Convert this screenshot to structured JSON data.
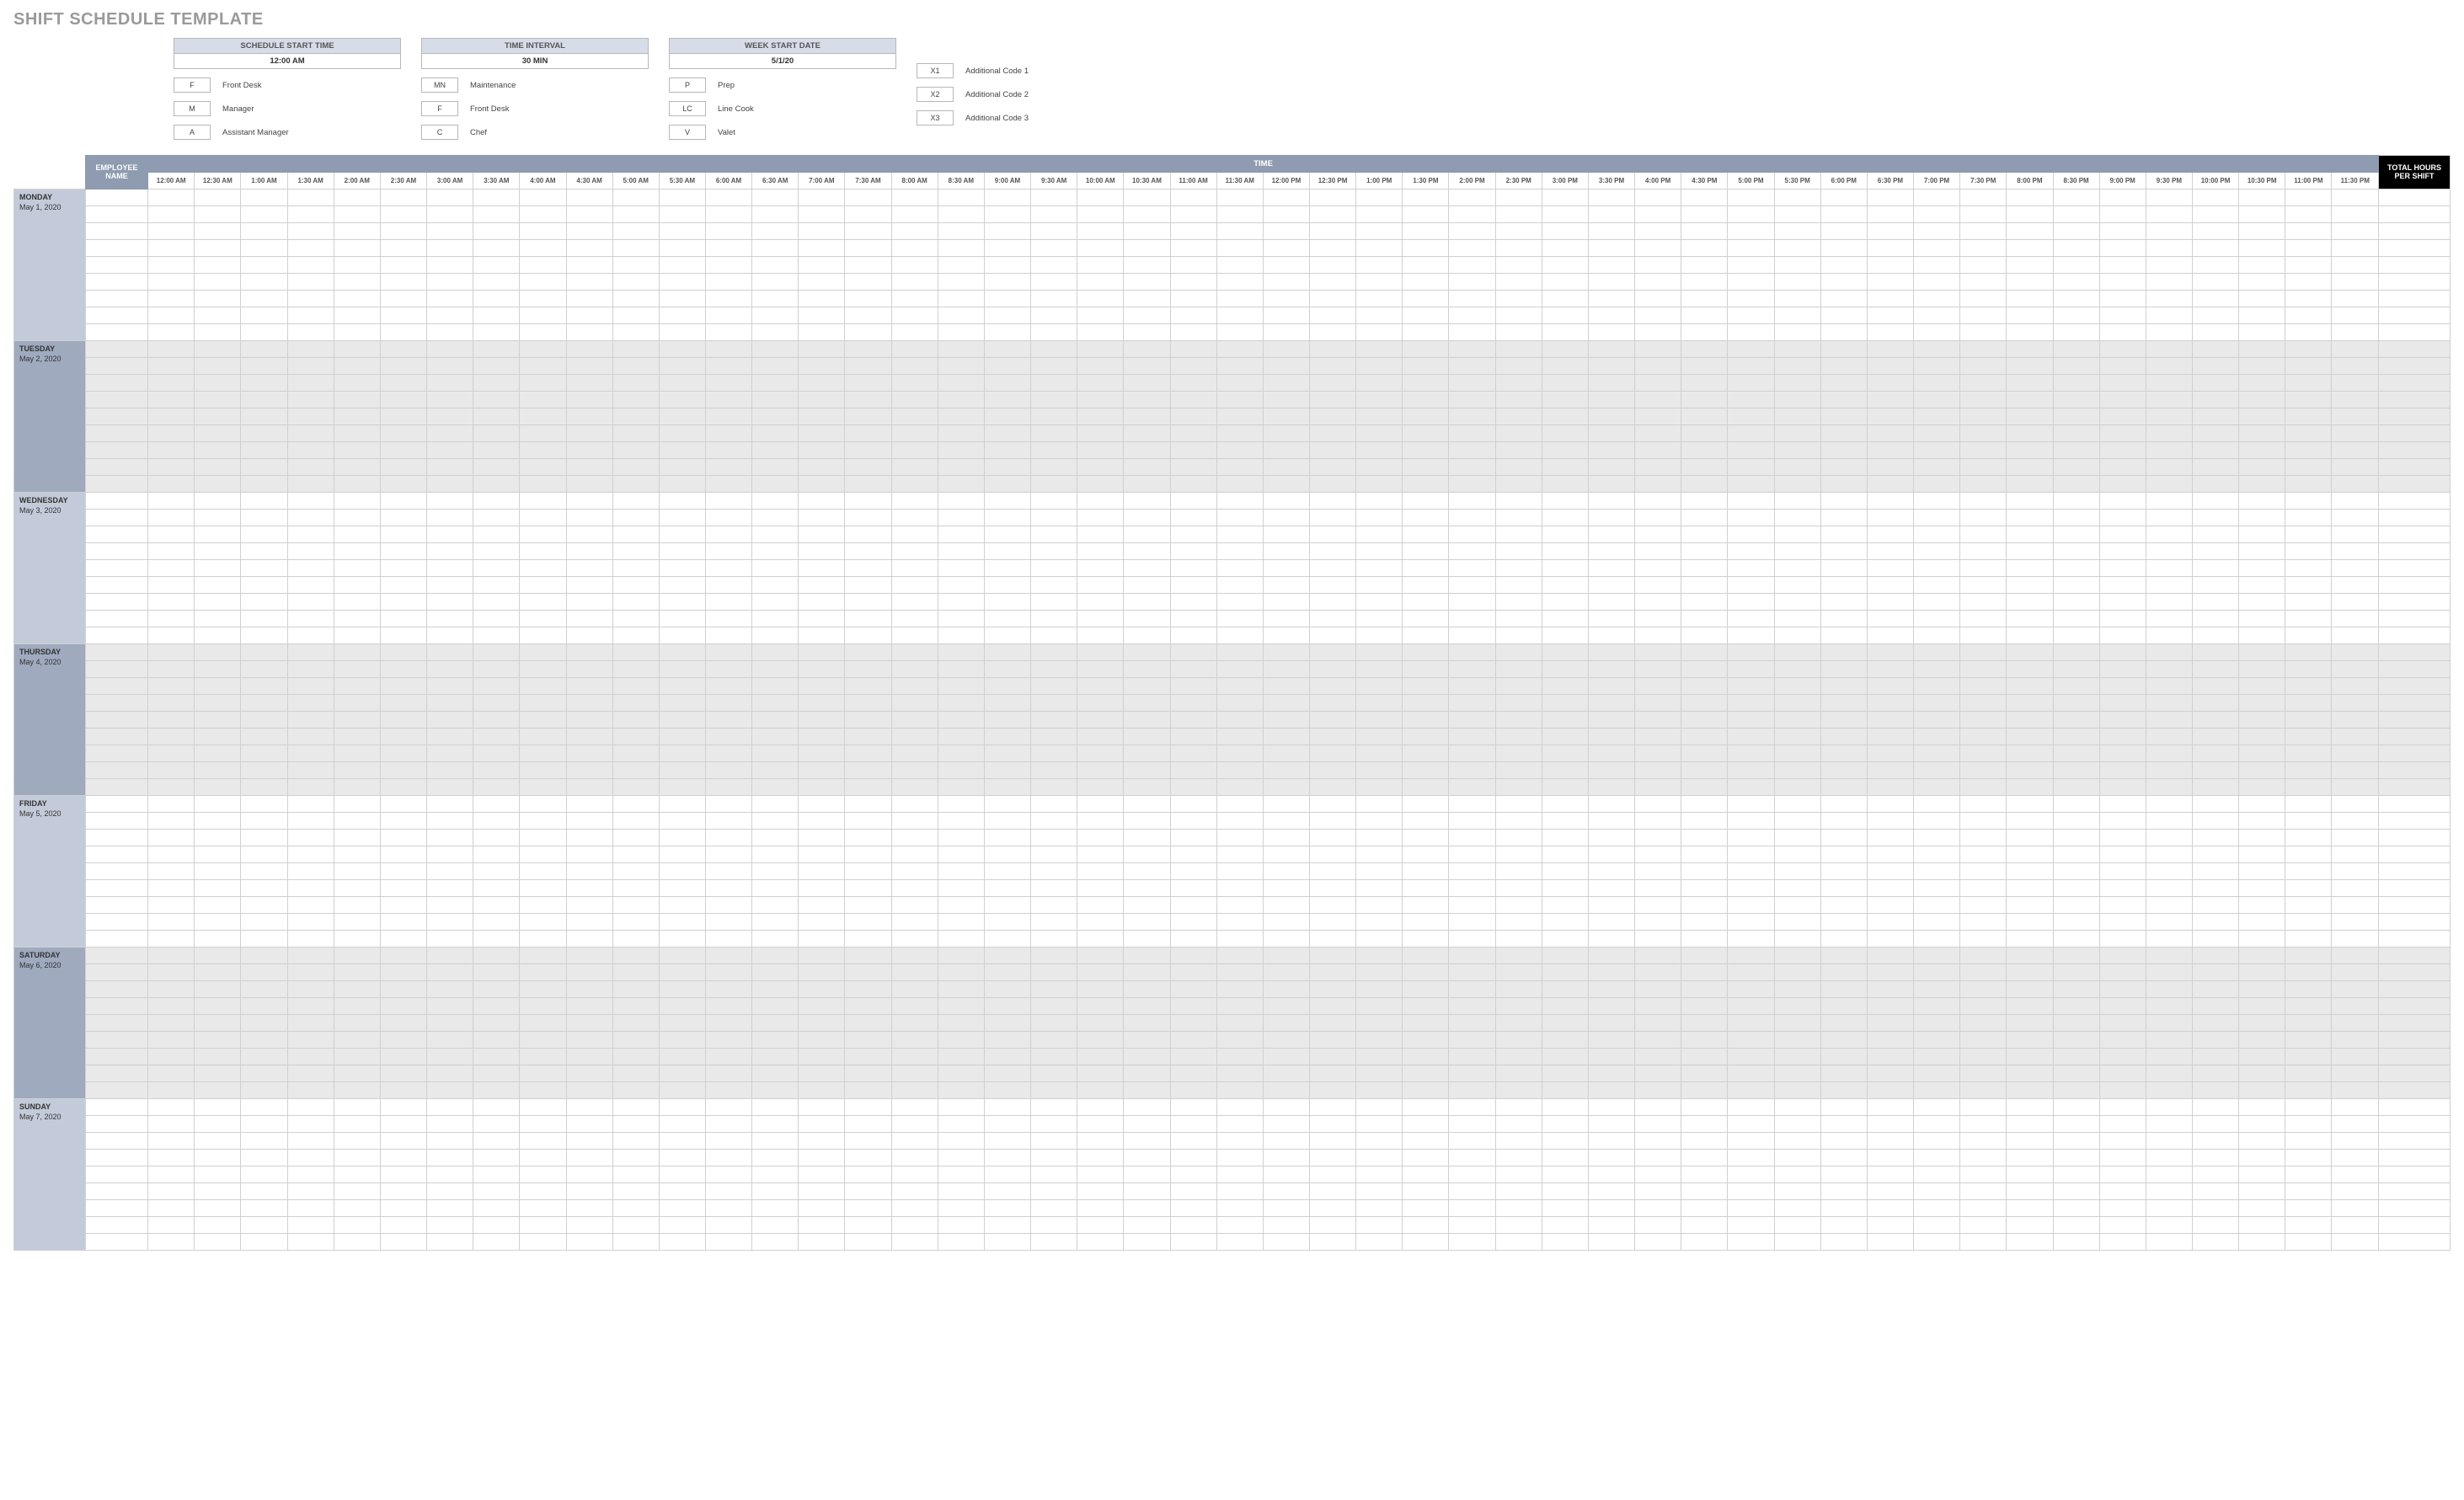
{
  "title": "SHIFT SCHEDULE TEMPLATE",
  "config": {
    "start_time": {
      "label": "SCHEDULE START TIME",
      "value": "12:00 AM"
    },
    "interval": {
      "label": "TIME INTERVAL",
      "value": "30 MIN"
    },
    "week_start": {
      "label": "WEEK START DATE",
      "value": "5/1/20"
    }
  },
  "legend_cols": [
    [
      {
        "code": "F",
        "label": "Front Desk"
      },
      {
        "code": "M",
        "label": "Manager"
      },
      {
        "code": "A",
        "label": "Assistant Manager"
      }
    ],
    [
      {
        "code": "MN",
        "label": "Maintenance"
      },
      {
        "code": "F",
        "label": "Front Desk"
      },
      {
        "code": "C",
        "label": "Chef"
      }
    ],
    [
      {
        "code": "P",
        "label": "Prep"
      },
      {
        "code": "LC",
        "label": "Line Cook"
      },
      {
        "code": "V",
        "label": "Valet"
      }
    ]
  ],
  "legend_extra": [
    {
      "code": "X1",
      "label": "Additional Code 1"
    },
    {
      "code": "X2",
      "label": "Additional Code 2"
    },
    {
      "code": "X3",
      "label": "Additional Code 3"
    }
  ],
  "headers": {
    "employee": "EMPLOYEE NAME",
    "time": "TIME",
    "total": "TOTAL HOURS PER SHIFT"
  },
  "time_slots": [
    "12:00 AM",
    "12:30 AM",
    "1:00 AM",
    "1:30 AM",
    "2:00 AM",
    "2:30 AM",
    "3:00 AM",
    "3:30 AM",
    "4:00 AM",
    "4:30 AM",
    "5:00 AM",
    "5:30 AM",
    "6:00 AM",
    "6:30 AM",
    "7:00 AM",
    "7:30 AM",
    "8:00 AM",
    "8:30 AM",
    "9:00 AM",
    "9:30 AM",
    "10:00 AM",
    "10:30 AM",
    "11:00 AM",
    "11:30 AM",
    "12:00 PM",
    "12:30 PM",
    "1:00 PM",
    "1:30 PM",
    "2:00 PM",
    "2:30 PM",
    "3:00 PM",
    "3:30 PM",
    "4:00 PM",
    "4:30 PM",
    "5:00 PM",
    "5:30 PM",
    "6:00 PM",
    "6:30 PM",
    "7:00 PM",
    "7:30 PM",
    "8:00 PM",
    "8:30 PM",
    "9:00 PM",
    "9:30 PM",
    "10:00 PM",
    "10:30 PM",
    "11:00 PM",
    "11:30 PM"
  ],
  "days": [
    {
      "name": "MONDAY",
      "date": "May 1, 2020",
      "shade": "light",
      "stripe": "a"
    },
    {
      "name": "TUESDAY",
      "date": "May 2, 2020",
      "shade": "dark",
      "stripe": "b"
    },
    {
      "name": "WEDNESDAY",
      "date": "May 3, 2020",
      "shade": "light",
      "stripe": "a"
    },
    {
      "name": "THURSDAY",
      "date": "May 4, 2020",
      "shade": "dark",
      "stripe": "b"
    },
    {
      "name": "FRIDAY",
      "date": "May 5, 2020",
      "shade": "light",
      "stripe": "a"
    },
    {
      "name": "SATURDAY",
      "date": "May 6, 2020",
      "shade": "dark",
      "stripe": "b"
    },
    {
      "name": "SUNDAY",
      "date": "May 7, 2020",
      "shade": "light",
      "stripe": "a"
    }
  ],
  "rows_per_day": 9
}
